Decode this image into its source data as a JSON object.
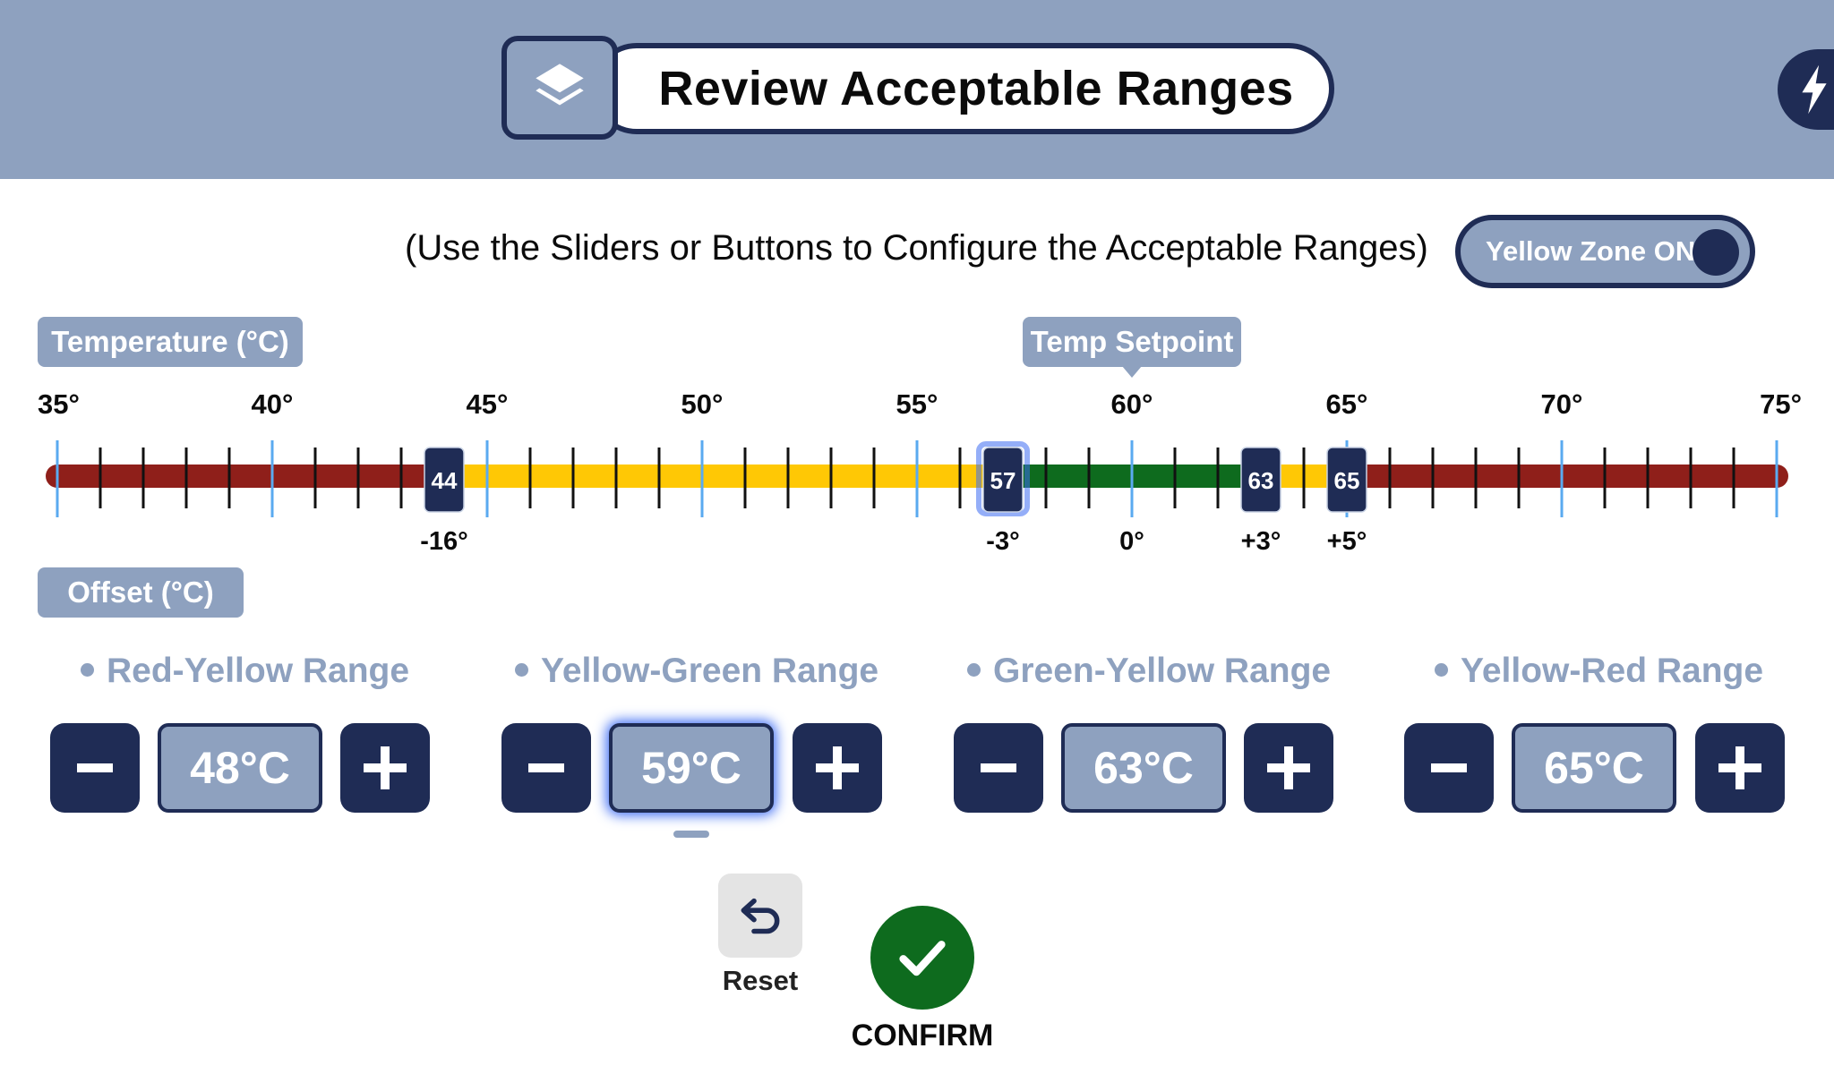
{
  "header": {
    "title": "Review Acceptable Ranges",
    "layers_icon": "layers-icon",
    "quick_action_icon": "lightning-bolt-icon"
  },
  "instruction": "(Use the Sliders or Buttons to Configure the Acceptable Ranges)",
  "yellow_zone_toggle": {
    "label": "Yellow Zone ON",
    "state": "on"
  },
  "temperature_axis": {
    "label": "Temperature (°C)",
    "min": 35,
    "max": 75,
    "minor_step": 1,
    "major_ticks": [
      35,
      40,
      45,
      50,
      55,
      60,
      65,
      70,
      75
    ],
    "major_tick_labels": [
      "35°",
      "40°",
      "45°",
      "50°",
      "55°",
      "60°",
      "65°",
      "70°",
      "75°"
    ]
  },
  "setpoint": {
    "label": "Temp Setpoint",
    "value": 60
  },
  "offset_axis": {
    "label": "Offset (°C)",
    "labels": [
      {
        "value": 44,
        "text": "-16°"
      },
      {
        "value": 57,
        "text": "-3°"
      },
      {
        "value": 60,
        "text": "0°"
      },
      {
        "value": 63,
        "text": "+3°"
      },
      {
        "value": 65,
        "text": "+5°"
      }
    ]
  },
  "zones": [
    {
      "name": "red",
      "from": 35,
      "to": 44,
      "color": "#8f1f1a"
    },
    {
      "name": "yellow",
      "from": 44,
      "to": 57,
      "color": "#ffc805"
    },
    {
      "name": "green",
      "from": 57,
      "to": 63,
      "color": "#0e6b1e"
    },
    {
      "name": "yellow",
      "from": 63,
      "to": 65,
      "color": "#ffc805"
    },
    {
      "name": "red",
      "from": 65,
      "to": 75,
      "color": "#8f1f1a"
    }
  ],
  "handles": [
    {
      "value": 44,
      "label": "44",
      "active": false
    },
    {
      "value": 57,
      "label": "57",
      "active": true
    },
    {
      "value": 63,
      "label": "63",
      "active": false
    },
    {
      "value": 65,
      "label": "65",
      "active": false
    }
  ],
  "ranges": [
    {
      "title": "Red-Yellow Range",
      "value": "48°C",
      "active": false
    },
    {
      "title": "Yellow-Green Range",
      "value": "59°C",
      "active": true
    },
    {
      "title": "Green-Yellow Range",
      "value": "63°C",
      "active": false
    },
    {
      "title": "Yellow-Red Range",
      "value": "65°C",
      "active": false
    }
  ],
  "actions": {
    "reset_label": "Reset",
    "reset_icon": "undo-arrow-icon",
    "confirm_label": "CONFIRM",
    "confirm_icon": "checkmark-icon"
  },
  "colors": {
    "navy": "#1f2c55",
    "slate": "#8ea1bf",
    "tick_major": "#5aaaf0",
    "handle_glow": "#3d6cf3"
  }
}
